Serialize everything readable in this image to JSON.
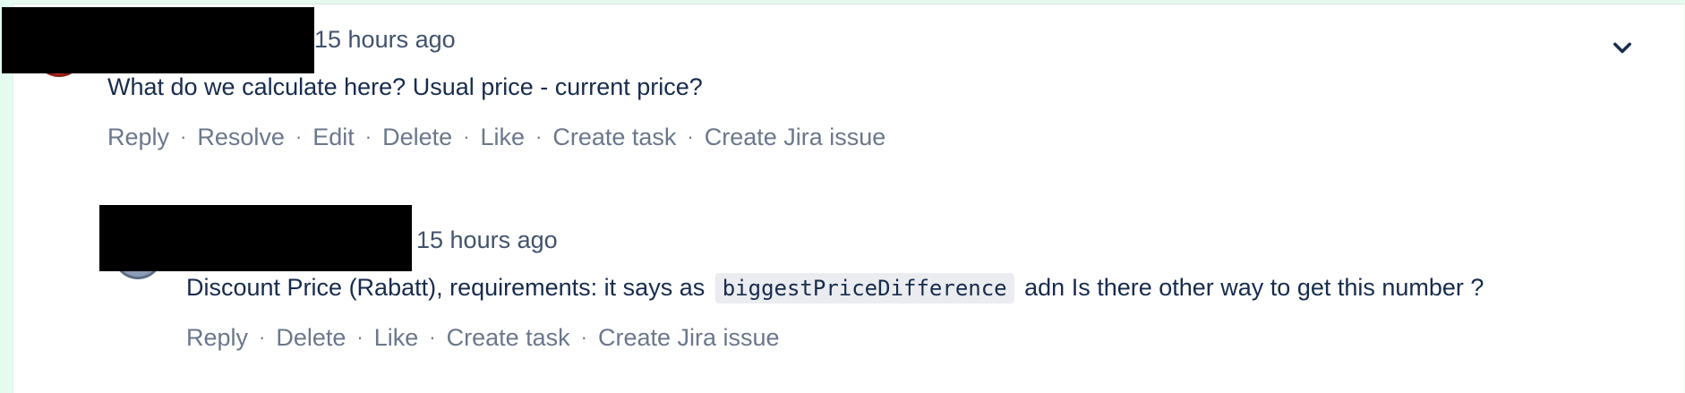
{
  "comments": [
    {
      "author_redacted": true,
      "timestamp": "15 hours ago",
      "body": "What do we calculate here? Usual price - current price?",
      "actions": [
        "Reply",
        "Resolve",
        "Edit",
        "Delete",
        "Like",
        "Create task",
        "Create Jira issue"
      ],
      "separator": "·"
    },
    {
      "author_redacted": true,
      "timestamp": "15 hours ago",
      "body_before": "Discount Price (Rabatt), requirements: it says as",
      "body_code": "biggestPriceDifference",
      "body_after": "adn Is there other way to get this number ?",
      "actions": [
        "Reply",
        "Delete",
        "Like",
        "Create task",
        "Create Jira issue"
      ],
      "separator": "·"
    }
  ],
  "icons": {
    "collapse": "chevron-down-icon"
  },
  "colors": {
    "background_accent": "#E3FCEF",
    "text_primary": "#172B4D",
    "text_secondary": "#6B778C",
    "code_background": "#EBECF0"
  }
}
